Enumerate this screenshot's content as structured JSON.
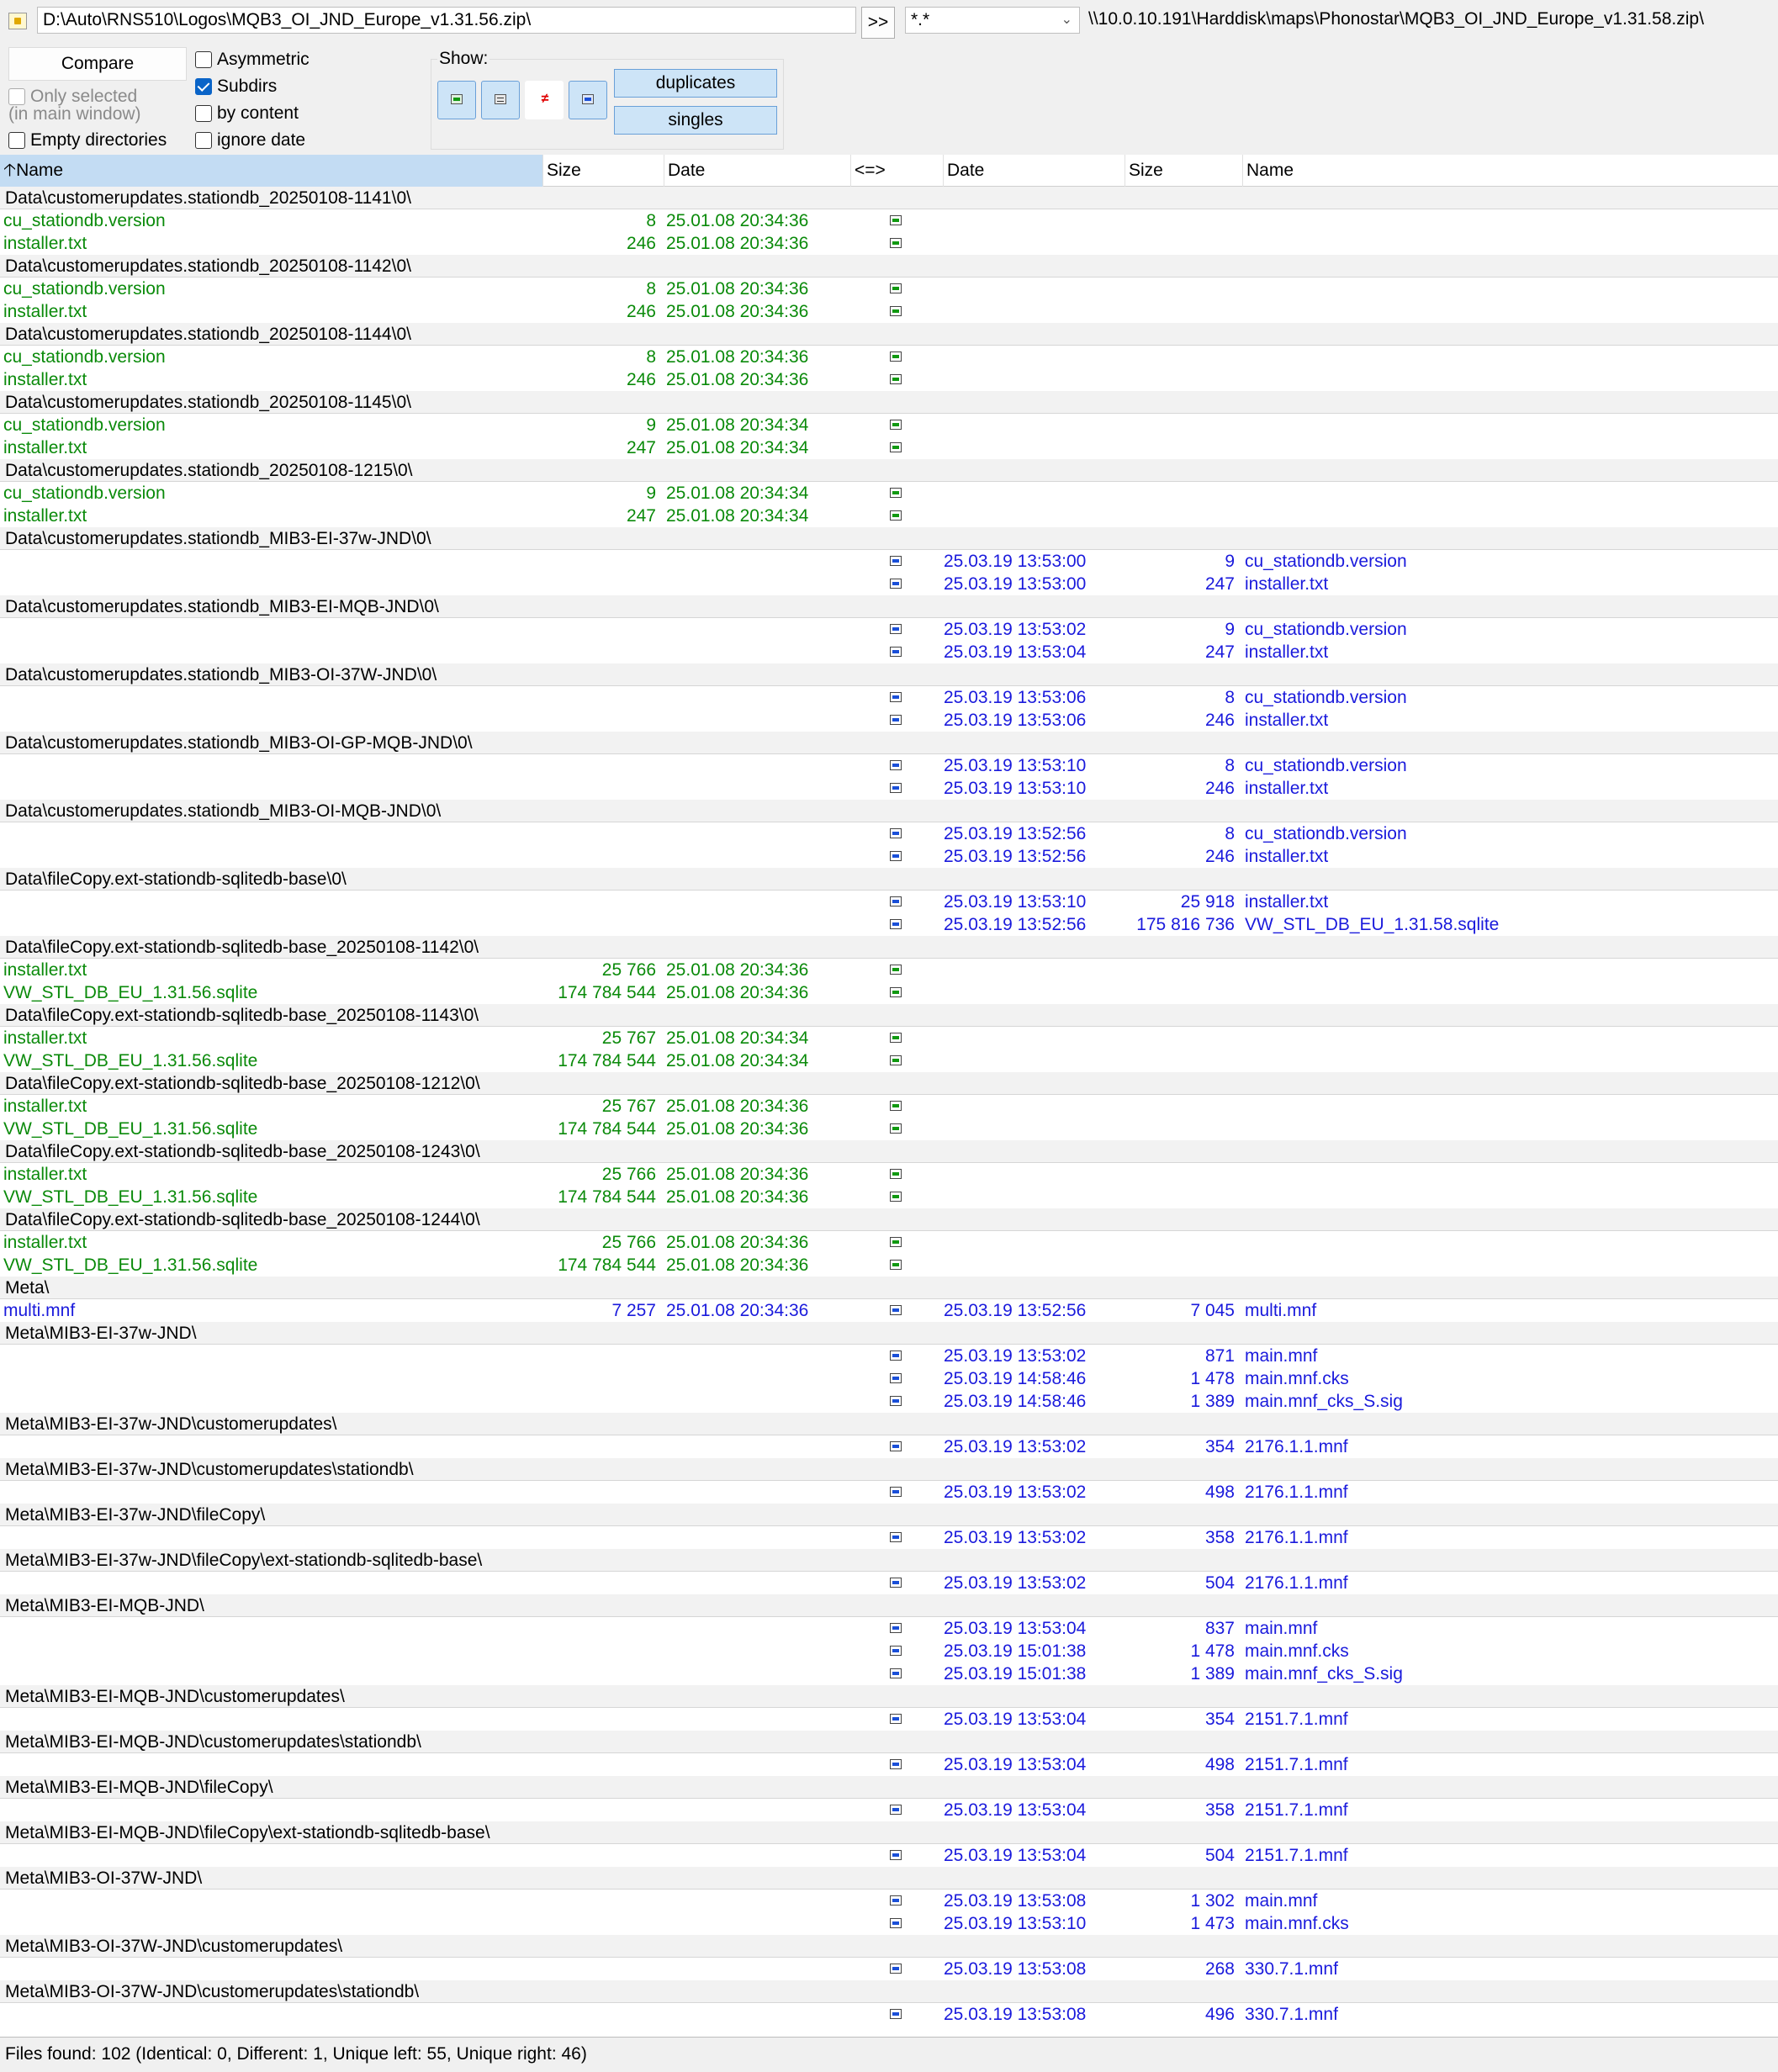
{
  "top": {
    "left_path": "D:\\Auto\\RNS510\\Logos\\MQB3_OI_JND_Europe_v1.31.56.zip\\",
    "swap_label": ">>",
    "filter_value": "*.*",
    "right_path": "\\\\10.0.10.191\\Harddisk\\maps\\Phonostar\\MQB3_OI_JND_Europe_v1.31.58.zip\\"
  },
  "options": {
    "compare_label": "Compare",
    "only_selected": "Only selected",
    "in_main_window": "(in main window)",
    "empty_dirs": "Empty directories",
    "asymmetric": "Asymmetric",
    "subdirs": "Subdirs",
    "by_content": "by content",
    "ignore_date": "ignore date",
    "show_label": "Show:",
    "duplicates": "duplicates",
    "singles": "singles"
  },
  "columns": {
    "name_left": "Name",
    "size_left": "Size",
    "date_left": "Date",
    "compare": "<=>",
    "date_right": "Date",
    "size_right": "Size",
    "name_right": "Name"
  },
  "rows": [
    {
      "type": "dir",
      "name": "Data\\customerupdates.stationdb_20250108-1141\\0\\"
    },
    {
      "type": "left",
      "lname": "cu_stationdb.version",
      "lsize": "8",
      "ldate": "25.01.08 20:34:36"
    },
    {
      "type": "left",
      "lname": "installer.txt",
      "lsize": "246",
      "ldate": "25.01.08 20:34:36"
    },
    {
      "type": "dir",
      "name": "Data\\customerupdates.stationdb_20250108-1142\\0\\"
    },
    {
      "type": "left",
      "lname": "cu_stationdb.version",
      "lsize": "8",
      "ldate": "25.01.08 20:34:36"
    },
    {
      "type": "left",
      "lname": "installer.txt",
      "lsize": "246",
      "ldate": "25.01.08 20:34:36"
    },
    {
      "type": "dir",
      "name": "Data\\customerupdates.stationdb_20250108-1144\\0\\"
    },
    {
      "type": "left",
      "lname": "cu_stationdb.version",
      "lsize": "8",
      "ldate": "25.01.08 20:34:36"
    },
    {
      "type": "left",
      "lname": "installer.txt",
      "lsize": "246",
      "ldate": "25.01.08 20:34:36"
    },
    {
      "type": "dir",
      "name": "Data\\customerupdates.stationdb_20250108-1145\\0\\"
    },
    {
      "type": "left",
      "lname": "cu_stationdb.version",
      "lsize": "9",
      "ldate": "25.01.08 20:34:34"
    },
    {
      "type": "left",
      "lname": "installer.txt",
      "lsize": "247",
      "ldate": "25.01.08 20:34:34"
    },
    {
      "type": "dir",
      "name": "Data\\customerupdates.stationdb_20250108-1215\\0\\"
    },
    {
      "type": "left",
      "lname": "cu_stationdb.version",
      "lsize": "9",
      "ldate": "25.01.08 20:34:34"
    },
    {
      "type": "left",
      "lname": "installer.txt",
      "lsize": "247",
      "ldate": "25.01.08 20:34:34"
    },
    {
      "type": "dir",
      "name": "Data\\customerupdates.stationdb_MIB3-EI-37w-JND\\0\\"
    },
    {
      "type": "right",
      "rdate": "25.03.19 13:53:00",
      "rsize": "9",
      "rname": "cu_stationdb.version"
    },
    {
      "type": "right",
      "rdate": "25.03.19 13:53:00",
      "rsize": "247",
      "rname": "installer.txt"
    },
    {
      "type": "dir",
      "name": "Data\\customerupdates.stationdb_MIB3-EI-MQB-JND\\0\\"
    },
    {
      "type": "right",
      "rdate": "25.03.19 13:53:02",
      "rsize": "9",
      "rname": "cu_stationdb.version"
    },
    {
      "type": "right",
      "rdate": "25.03.19 13:53:04",
      "rsize": "247",
      "rname": "installer.txt"
    },
    {
      "type": "dir",
      "name": "Data\\customerupdates.stationdb_MIB3-OI-37W-JND\\0\\"
    },
    {
      "type": "right",
      "rdate": "25.03.19 13:53:06",
      "rsize": "8",
      "rname": "cu_stationdb.version"
    },
    {
      "type": "right",
      "rdate": "25.03.19 13:53:06",
      "rsize": "246",
      "rname": "installer.txt"
    },
    {
      "type": "dir",
      "name": "Data\\customerupdates.stationdb_MIB3-OI-GP-MQB-JND\\0\\"
    },
    {
      "type": "right",
      "rdate": "25.03.19 13:53:10",
      "rsize": "8",
      "rname": "cu_stationdb.version"
    },
    {
      "type": "right",
      "rdate": "25.03.19 13:53:10",
      "rsize": "246",
      "rname": "installer.txt"
    },
    {
      "type": "dir",
      "name": "Data\\customerupdates.stationdb_MIB3-OI-MQB-JND\\0\\"
    },
    {
      "type": "right",
      "rdate": "25.03.19 13:52:56",
      "rsize": "8",
      "rname": "cu_stationdb.version"
    },
    {
      "type": "right",
      "rdate": "25.03.19 13:52:56",
      "rsize": "246",
      "rname": "installer.txt"
    },
    {
      "type": "dir",
      "name": "Data\\fileCopy.ext-stationdb-sqlitedb-base\\0\\"
    },
    {
      "type": "right",
      "rdate": "25.03.19 13:53:10",
      "rsize": "25 918",
      "rname": "installer.txt"
    },
    {
      "type": "right",
      "rdate": "25.03.19 13:52:56",
      "rsize": "175 816 736",
      "rname": "VW_STL_DB_EU_1.31.58.sqlite"
    },
    {
      "type": "dir",
      "name": "Data\\fileCopy.ext-stationdb-sqlitedb-base_20250108-1142\\0\\"
    },
    {
      "type": "left",
      "lname": "installer.txt",
      "lsize": "25 766",
      "ldate": "25.01.08 20:34:36"
    },
    {
      "type": "left",
      "lname": "VW_STL_DB_EU_1.31.56.sqlite",
      "lsize": "174 784 544",
      "ldate": "25.01.08 20:34:36"
    },
    {
      "type": "dir",
      "name": "Data\\fileCopy.ext-stationdb-sqlitedb-base_20250108-1143\\0\\"
    },
    {
      "type": "left",
      "lname": "installer.txt",
      "lsize": "25 767",
      "ldate": "25.01.08 20:34:34"
    },
    {
      "type": "left",
      "lname": "VW_STL_DB_EU_1.31.56.sqlite",
      "lsize": "174 784 544",
      "ldate": "25.01.08 20:34:34"
    },
    {
      "type": "dir",
      "name": "Data\\fileCopy.ext-stationdb-sqlitedb-base_20250108-1212\\0\\"
    },
    {
      "type": "left",
      "lname": "installer.txt",
      "lsize": "25 767",
      "ldate": "25.01.08 20:34:36"
    },
    {
      "type": "left",
      "lname": "VW_STL_DB_EU_1.31.56.sqlite",
      "lsize": "174 784 544",
      "ldate": "25.01.08 20:34:36"
    },
    {
      "type": "dir",
      "name": "Data\\fileCopy.ext-stationdb-sqlitedb-base_20250108-1243\\0\\"
    },
    {
      "type": "left",
      "lname": "installer.txt",
      "lsize": "25 766",
      "ldate": "25.01.08 20:34:36"
    },
    {
      "type": "left",
      "lname": "VW_STL_DB_EU_1.31.56.sqlite",
      "lsize": "174 784 544",
      "ldate": "25.01.08 20:34:36"
    },
    {
      "type": "dir",
      "name": "Data\\fileCopy.ext-stationdb-sqlitedb-base_20250108-1244\\0\\"
    },
    {
      "type": "left",
      "lname": "installer.txt",
      "lsize": "25 766",
      "ldate": "25.01.08 20:34:36"
    },
    {
      "type": "left",
      "lname": "VW_STL_DB_EU_1.31.56.sqlite",
      "lsize": "174 784 544",
      "ldate": "25.01.08 20:34:36"
    },
    {
      "type": "dir",
      "name": "Meta\\"
    },
    {
      "type": "diff",
      "lname": "multi.mnf",
      "lsize": "7 257",
      "ldate": "25.01.08 20:34:36",
      "rdate": "25.03.19 13:52:56",
      "rsize": "7 045",
      "rname": "multi.mnf"
    },
    {
      "type": "dir",
      "name": "Meta\\MIB3-EI-37w-JND\\"
    },
    {
      "type": "right",
      "rdate": "25.03.19 13:53:02",
      "rsize": "871",
      "rname": "main.mnf"
    },
    {
      "type": "right",
      "rdate": "25.03.19 14:58:46",
      "rsize": "1 478",
      "rname": "main.mnf.cks"
    },
    {
      "type": "right",
      "rdate": "25.03.19 14:58:46",
      "rsize": "1 389",
      "rname": "main.mnf_cks_S.sig"
    },
    {
      "type": "dir",
      "name": "Meta\\MIB3-EI-37w-JND\\customerupdates\\"
    },
    {
      "type": "right",
      "rdate": "25.03.19 13:53:02",
      "rsize": "354",
      "rname": "2176.1.1.mnf"
    },
    {
      "type": "dir",
      "name": "Meta\\MIB3-EI-37w-JND\\customerupdates\\stationdb\\"
    },
    {
      "type": "right",
      "rdate": "25.03.19 13:53:02",
      "rsize": "498",
      "rname": "2176.1.1.mnf"
    },
    {
      "type": "dir",
      "name": "Meta\\MIB3-EI-37w-JND\\fileCopy\\"
    },
    {
      "type": "right",
      "rdate": "25.03.19 13:53:02",
      "rsize": "358",
      "rname": "2176.1.1.mnf"
    },
    {
      "type": "dir",
      "name": "Meta\\MIB3-EI-37w-JND\\fileCopy\\ext-stationdb-sqlitedb-base\\"
    },
    {
      "type": "right",
      "rdate": "25.03.19 13:53:02",
      "rsize": "504",
      "rname": "2176.1.1.mnf"
    },
    {
      "type": "dir",
      "name": "Meta\\MIB3-EI-MQB-JND\\"
    },
    {
      "type": "right",
      "rdate": "25.03.19 13:53:04",
      "rsize": "837",
      "rname": "main.mnf"
    },
    {
      "type": "right",
      "rdate": "25.03.19 15:01:38",
      "rsize": "1 478",
      "rname": "main.mnf.cks"
    },
    {
      "type": "right",
      "rdate": "25.03.19 15:01:38",
      "rsize": "1 389",
      "rname": "main.mnf_cks_S.sig"
    },
    {
      "type": "dir",
      "name": "Meta\\MIB3-EI-MQB-JND\\customerupdates\\"
    },
    {
      "type": "right",
      "rdate": "25.03.19 13:53:04",
      "rsize": "354",
      "rname": "2151.7.1.mnf"
    },
    {
      "type": "dir",
      "name": "Meta\\MIB3-EI-MQB-JND\\customerupdates\\stationdb\\"
    },
    {
      "type": "right",
      "rdate": "25.03.19 13:53:04",
      "rsize": "498",
      "rname": "2151.7.1.mnf"
    },
    {
      "type": "dir",
      "name": "Meta\\MIB3-EI-MQB-JND\\fileCopy\\"
    },
    {
      "type": "right",
      "rdate": "25.03.19 13:53:04",
      "rsize": "358",
      "rname": "2151.7.1.mnf"
    },
    {
      "type": "dir",
      "name": "Meta\\MIB3-EI-MQB-JND\\fileCopy\\ext-stationdb-sqlitedb-base\\"
    },
    {
      "type": "right",
      "rdate": "25.03.19 13:53:04",
      "rsize": "504",
      "rname": "2151.7.1.mnf"
    },
    {
      "type": "dir",
      "name": "Meta\\MIB3-OI-37W-JND\\"
    },
    {
      "type": "right",
      "rdate": "25.03.19 13:53:08",
      "rsize": "1 302",
      "rname": "main.mnf"
    },
    {
      "type": "right",
      "rdate": "25.03.19 13:53:10",
      "rsize": "1 473",
      "rname": "main.mnf.cks"
    },
    {
      "type": "dir",
      "name": "Meta\\MIB3-OI-37W-JND\\customerupdates\\"
    },
    {
      "type": "right",
      "rdate": "25.03.19 13:53:08",
      "rsize": "268",
      "rname": "330.7.1.mnf"
    },
    {
      "type": "dir",
      "name": "Meta\\MIB3-OI-37W-JND\\customerupdates\\stationdb\\"
    },
    {
      "type": "right",
      "rdate": "25.03.19 13:53:08",
      "rsize": "496",
      "rname": "330.7.1.mnf"
    }
  ],
  "status": "Files found: 102  (Identical: 0, Different: 1, Unique left: 55, Unique right: 46)"
}
